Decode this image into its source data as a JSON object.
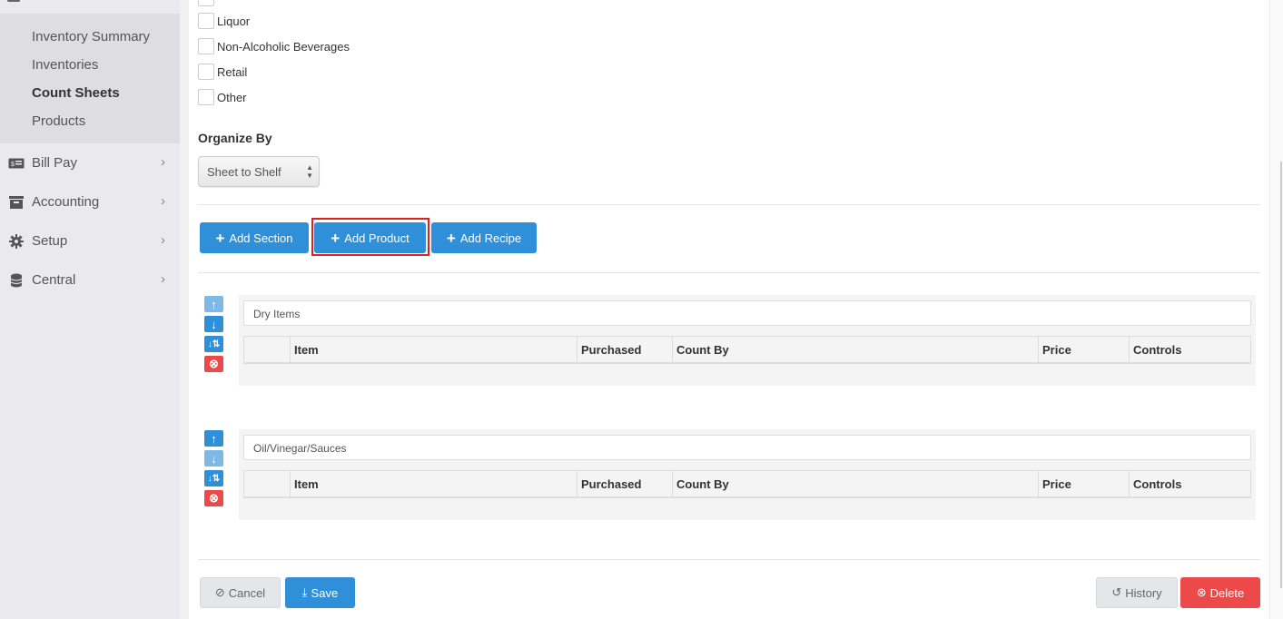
{
  "sidebar": {
    "sub_items": [
      {
        "label": "Inventory Summary",
        "active": false
      },
      {
        "label": "Inventories",
        "active": false
      },
      {
        "label": "Count Sheets",
        "active": true
      },
      {
        "label": "Products",
        "active": false
      }
    ],
    "nav_items": [
      {
        "label": "Bill Pay",
        "icon": "money-icon"
      },
      {
        "label": "Accounting",
        "icon": "inbox-icon"
      },
      {
        "label": "Setup",
        "icon": "gear-icon"
      },
      {
        "label": "Central",
        "icon": "database-icon"
      }
    ]
  },
  "categories": [
    {
      "label": "Liquor",
      "checked": false
    },
    {
      "label": "Non-Alcoholic Beverages",
      "checked": false
    },
    {
      "label": "Retail",
      "checked": false
    },
    {
      "label": "Other",
      "checked": false
    }
  ],
  "organize_by": {
    "label": "Organize By",
    "selected": "Sheet to Shelf"
  },
  "toolbar": {
    "add_section": "Add Section",
    "add_product": "Add Product",
    "add_recipe": "Add Recipe"
  },
  "table_headers": [
    "Item",
    "Purchased",
    "Count By",
    "Price",
    "Controls"
  ],
  "sections": [
    {
      "name": "Dry Items"
    },
    {
      "name": "Oil/Vinegar/Sauces"
    }
  ],
  "footer": {
    "cancel": "Cancel",
    "save": "Save",
    "history": "History",
    "delete": "Delete"
  },
  "colors": {
    "primary": "#2f8fd8",
    "danger": "#ec4a4a",
    "highlight": "#e02020"
  }
}
